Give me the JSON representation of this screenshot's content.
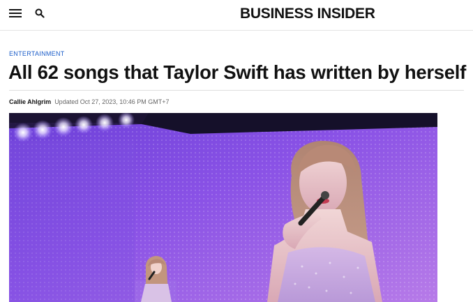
{
  "header": {
    "logo": "BUSINESS INSIDER",
    "menu_icon": "hamburger-menu-icon",
    "search_icon": "search-icon"
  },
  "article": {
    "kicker": "ENTERTAINMENT",
    "headline": "All 62 songs that Taylor Swift has written by herself",
    "author": "Callie Ahlgrim",
    "updated": "Updated Oct 27, 2023, 10:46 PM GMT+7"
  },
  "hero_image": {
    "description_icon": "concert-photo"
  }
}
